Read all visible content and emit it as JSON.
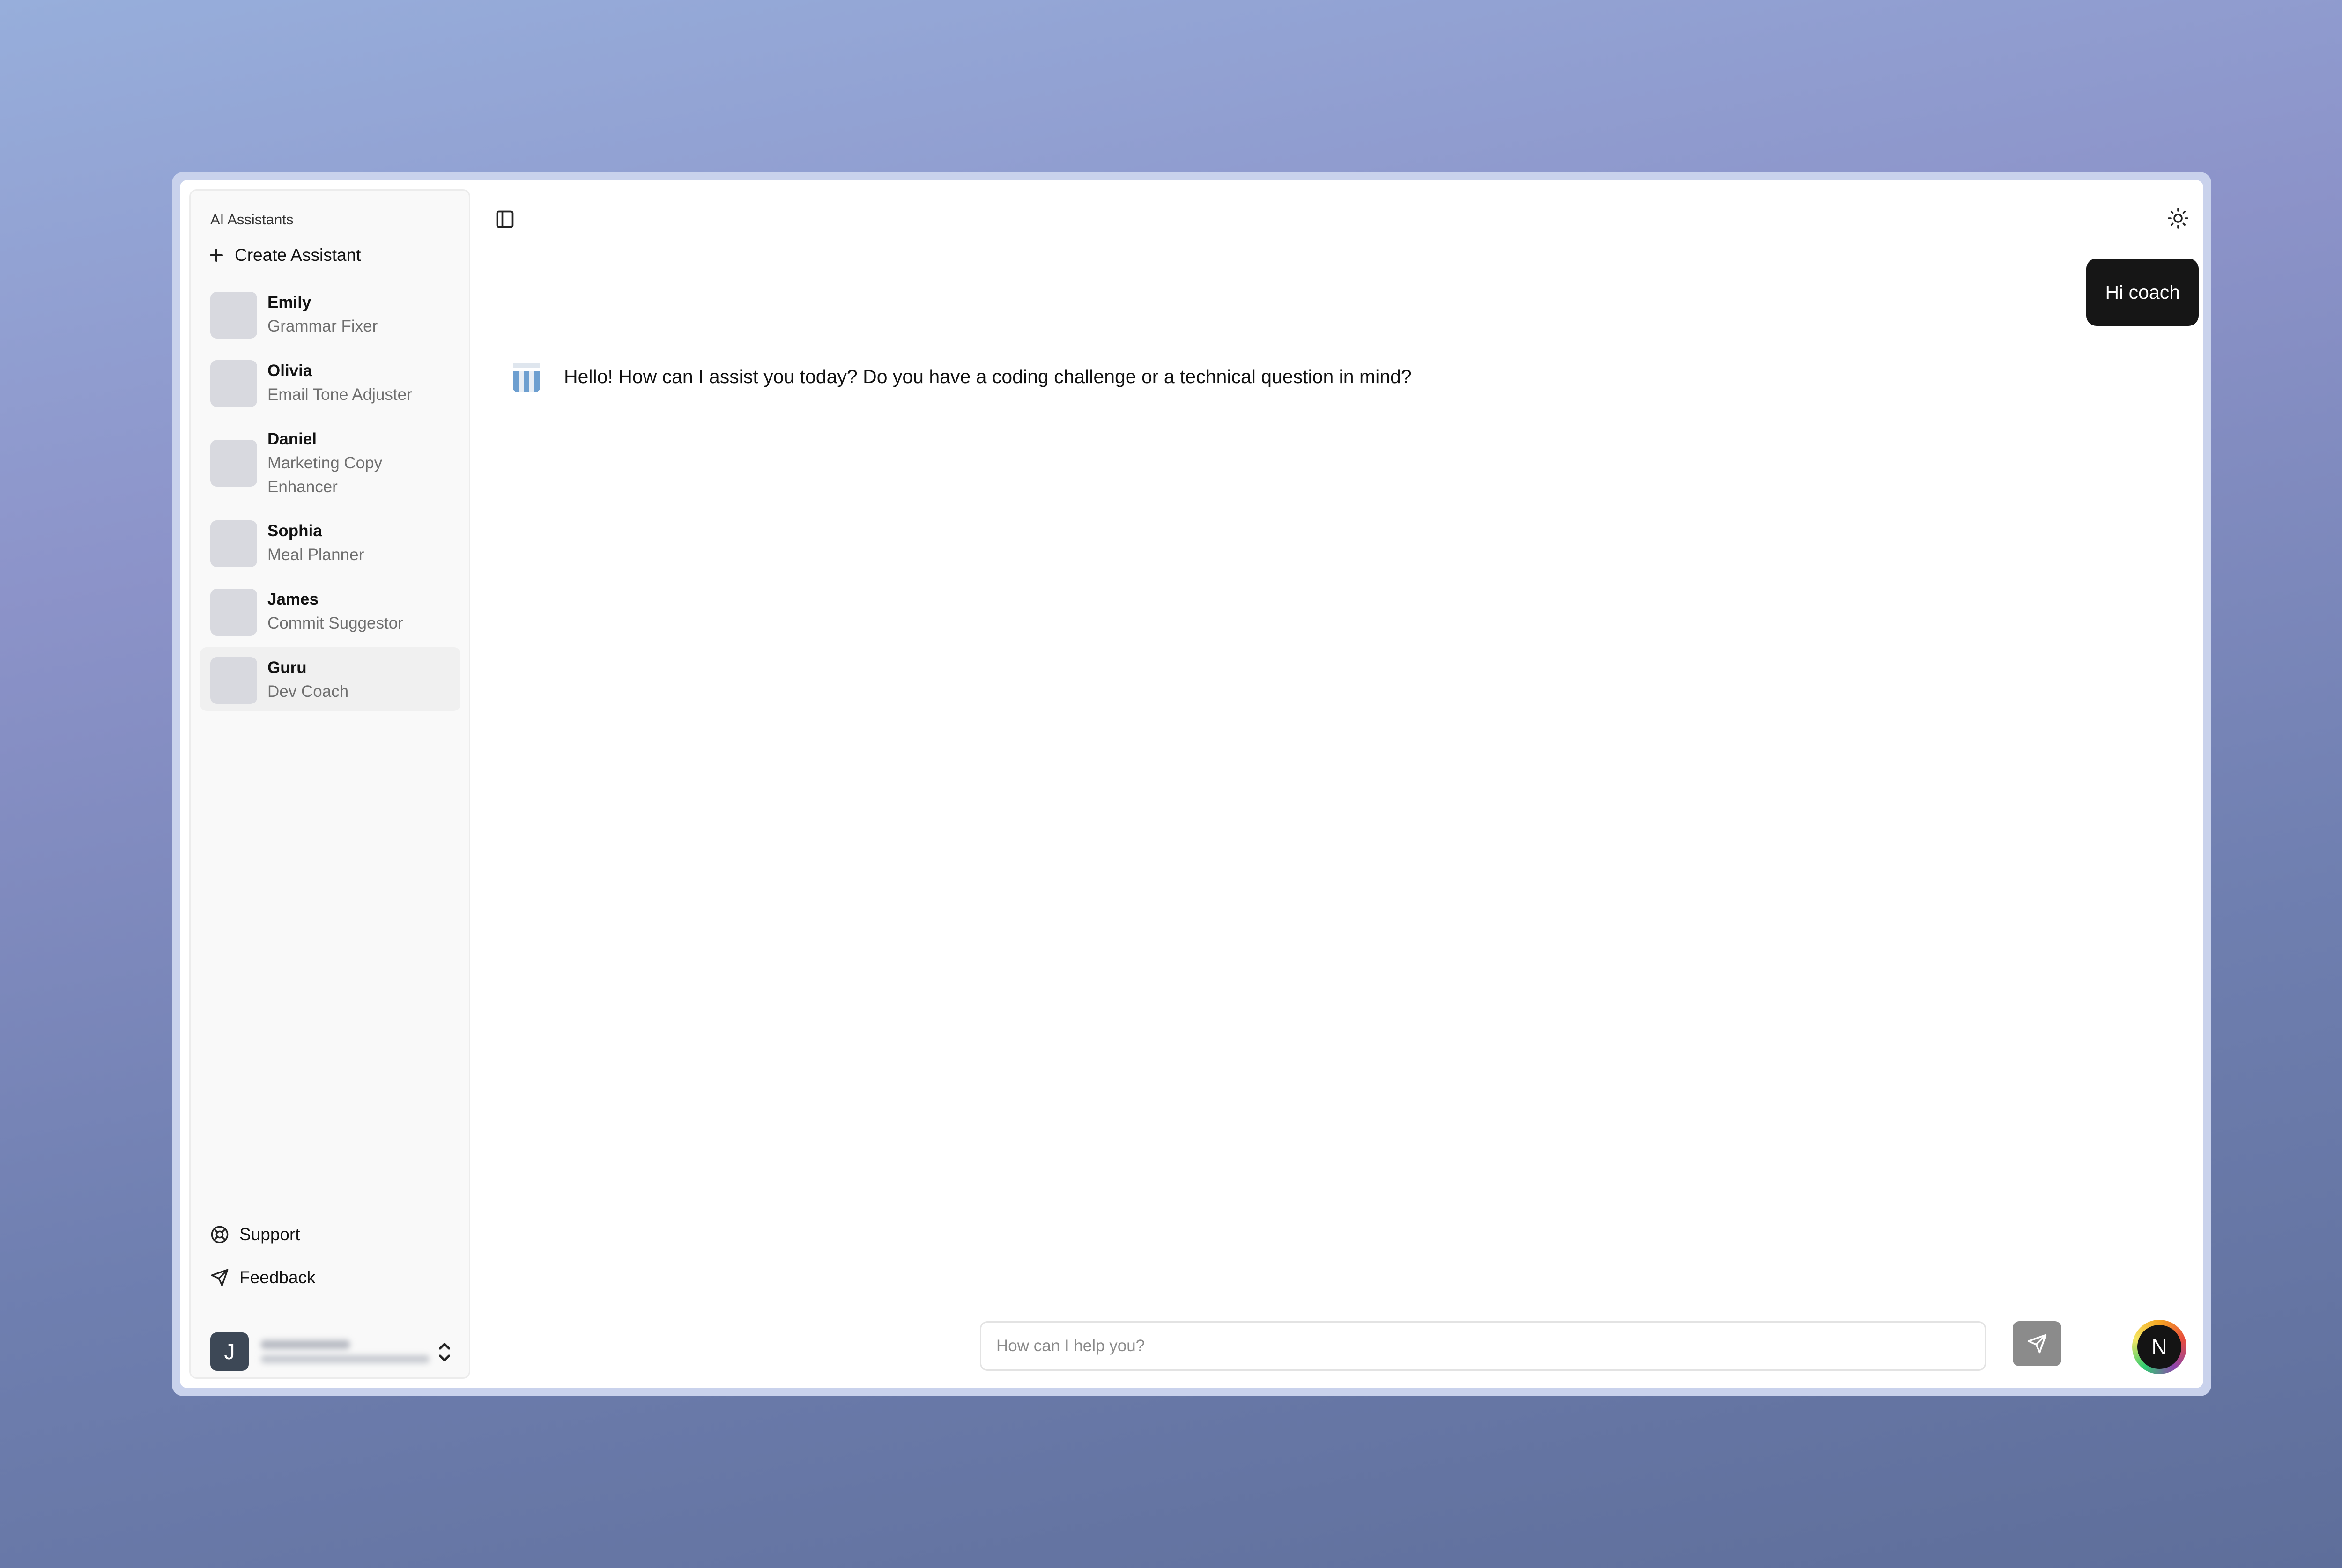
{
  "sidebar": {
    "title": "AI Assistants",
    "create_label": "Create Assistant",
    "assistants": [
      {
        "name": "Emily",
        "role": "Grammar Fixer"
      },
      {
        "name": "Olivia",
        "role": "Email Tone Adjuster"
      },
      {
        "name": "Daniel",
        "role": "Marketing Copy Enhancer"
      },
      {
        "name": "Sophia",
        "role": "Meal Planner"
      },
      {
        "name": "James",
        "role": "Commit Suggestor"
      },
      {
        "name": "Guru",
        "role": "Dev Coach"
      }
    ],
    "active_assistant": "Guru",
    "support_label": "Support",
    "feedback_label": "Feedback",
    "user": {
      "initial": "J"
    }
  },
  "chat": {
    "user_message": "Hi coach",
    "assistant_message": "Hello! How can I assist you today? Do you have a coding challenge or a technical question in mind?"
  },
  "composer": {
    "placeholder": "How can I help you?"
  },
  "badge": {
    "letter": "N"
  },
  "icons": {
    "panel_toggle": "sidebar-panel-icon",
    "theme_toggle": "sun-icon",
    "support": "lifebuoy-icon",
    "feedback": "send-icon",
    "send": "send-icon",
    "user_menu": "chevron-up-down-icon"
  },
  "colors": {
    "user_bubble": "#161616",
    "send_button": "#8b8b8b",
    "avatar_placeholder": "#d8d9df"
  }
}
